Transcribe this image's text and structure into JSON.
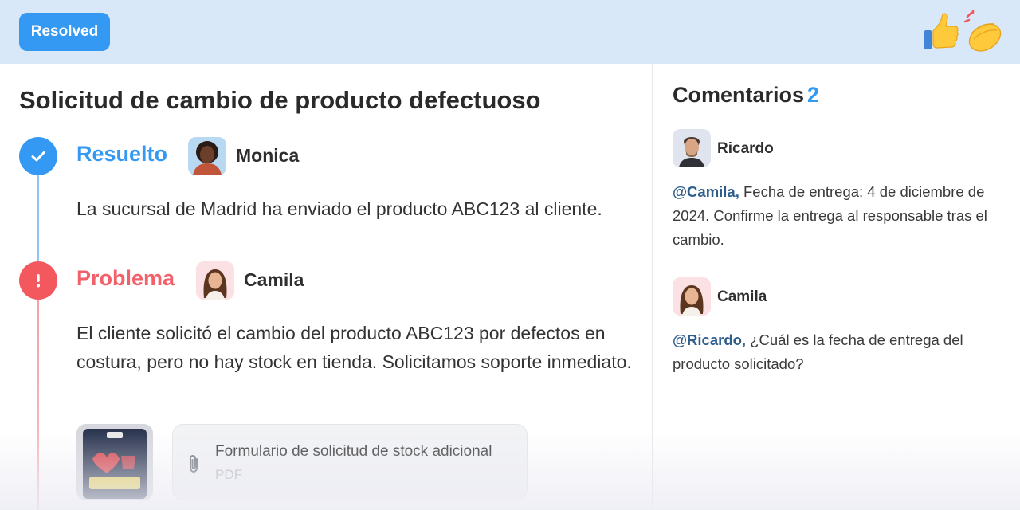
{
  "header": {
    "badge_label": "Resolved",
    "reactions": [
      "thumbs-up-icon",
      "clapping-hands-icon"
    ]
  },
  "ticket": {
    "title": "Solicitud de cambio de producto defectuoso",
    "events": [
      {
        "status": "Resuelto",
        "status_color": "#3399f3",
        "icon": "check-icon",
        "user": "Monica",
        "text": "La sucursal de Madrid ha enviado el producto ABC123 al cliente."
      },
      {
        "status": "Problema",
        "status_color": "#f2585e",
        "icon": "exclamation-icon",
        "user": "Camila",
        "text": "El cliente solicitó el cambio del producto ABC123 por defectos en costura, pero no hay stock en tienda. Solicitamos soporte inmediato.",
        "attachment": {
          "name": "Formulario de solicitud de stock adicional",
          "type": "PDF",
          "icon": "paperclip-icon"
        }
      }
    ]
  },
  "comments": {
    "title": "Comentarios",
    "count": "2",
    "items": [
      {
        "author": "Ricardo",
        "mention": "@Camila,",
        "text": " Fecha de entrega: 4 de diciembre de 2024. Confirme la entrega al responsable tras el cambio."
      },
      {
        "author": "Camila",
        "mention": "@Ricardo,",
        "text": " ¿Cuál es la fecha de entrega del producto solicitado?"
      }
    ]
  }
}
